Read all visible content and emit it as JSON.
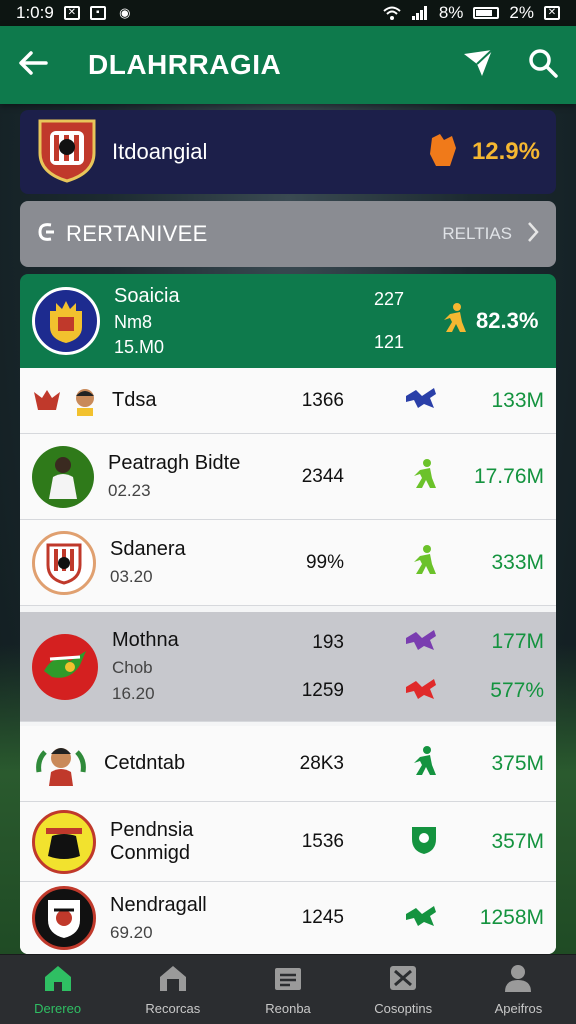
{
  "status_bar": {
    "time": "1:0:9",
    "battery_a": "8%",
    "battery_b": "2%"
  },
  "app_bar": {
    "title": "DLAHRRAGIA"
  },
  "hero": {
    "name": "Itdoangial",
    "percent": "12.9%"
  },
  "section": {
    "title": "RERTANIVEE",
    "link": "RELTIAS"
  },
  "featured": {
    "name": "Soaicia",
    "sub1": "Nm8",
    "sub2": "15.M0",
    "num1": "227",
    "num2": "121",
    "percent": "82.3%"
  },
  "rows": [
    {
      "name": "Tdsa",
      "sub": "",
      "num": "1366",
      "value": "133M",
      "icon_color": "#2a3fa8"
    },
    {
      "name": "Peatragh Bidte",
      "sub": "02.23",
      "num": "2344",
      "value": "17.76M",
      "icon_color": "#6bc22a"
    },
    {
      "name": "Sdanera",
      "sub": "03.20",
      "num": "99%",
      "value": "333M",
      "icon_color": "#6bc22a"
    },
    {
      "name": "Mothna",
      "sub": "Chob",
      "sub2": "16.20",
      "num": "193",
      "num2": "1259",
      "value": "177M",
      "value2": "577%",
      "icon_color": "#7a3db0",
      "icon_color2": "#e02a2a"
    },
    {
      "name": "Cetdntab",
      "sub": "",
      "num": "28K3",
      "value": "375M",
      "icon_color": "#14933f"
    },
    {
      "name": "Pendnsia Conmigd",
      "sub": "",
      "num": "1536",
      "value": "357M",
      "icon_color": "#14933f"
    },
    {
      "name": "Nendragall",
      "sub": "69.20",
      "num": "1245",
      "value": "1258M",
      "icon_color": "#14933f"
    }
  ],
  "bottom_nav": [
    {
      "label": "Derereo"
    },
    {
      "label": "Recorcas"
    },
    {
      "label": "Reonba"
    },
    {
      "label": "Cosoptins"
    },
    {
      "label": "Apeifros"
    }
  ],
  "colors": {
    "primary": "#0e7a4c",
    "hero_bg": "#1c1f4a",
    "accent": "#f5b731",
    "positive": "#14933f"
  }
}
